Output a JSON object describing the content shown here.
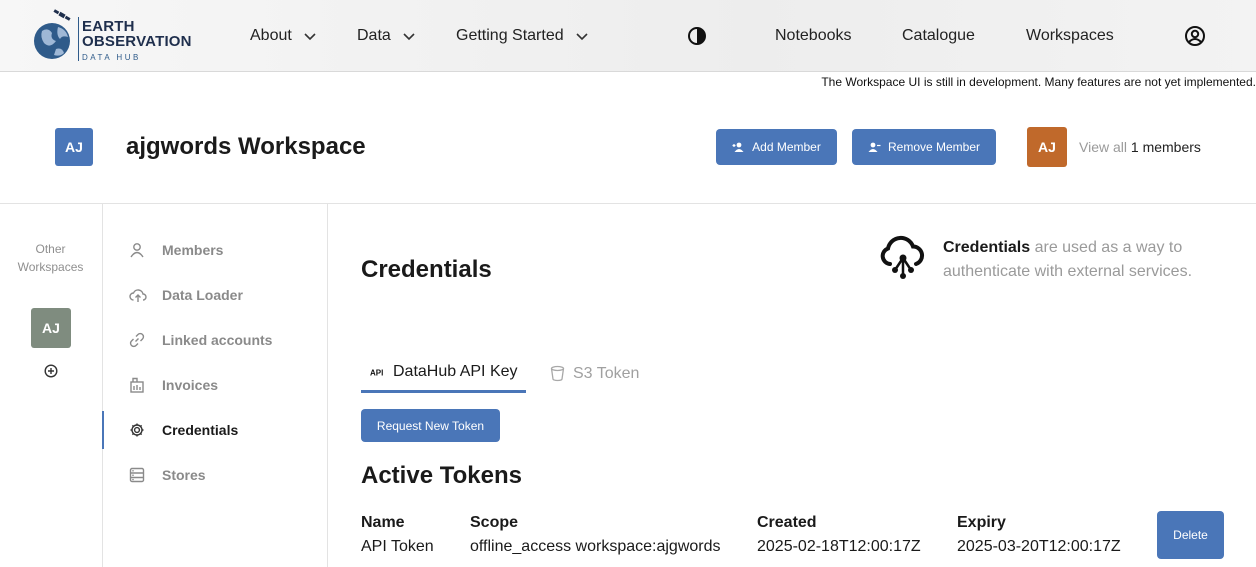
{
  "brand": {
    "line1": "EARTH",
    "line2": "OBSERVATION",
    "line3": "DATA HUB"
  },
  "nav": {
    "about": "About",
    "data": "Data",
    "getting_started": "Getting Started",
    "notebooks": "Notebooks",
    "catalogue": "Catalogue",
    "workspaces": "Workspaces"
  },
  "notice": "The Workspace UI is still in development. Many features are not yet implemented.",
  "workspace": {
    "initials": "AJ",
    "title": "ajgwords Workspace",
    "add_member": "Add Member",
    "remove_member": "Remove Member",
    "member_initials": "AJ",
    "view_all": "View all",
    "members_count": "1 members"
  },
  "rail": {
    "label": "Other Workspaces",
    "avatar": "AJ"
  },
  "menu": [
    {
      "label": "Members",
      "icon": "person-icon"
    },
    {
      "label": "Data Loader",
      "icon": "cloud-upload-icon"
    },
    {
      "label": "Linked accounts",
      "icon": "link-icon"
    },
    {
      "label": "Invoices",
      "icon": "invoice-icon"
    },
    {
      "label": "Credentials",
      "icon": "gear-icon",
      "active": true
    },
    {
      "label": "Stores",
      "icon": "storage-icon"
    }
  ],
  "credentials": {
    "title": "Credentials",
    "desc_bold": "Credentials",
    "desc_rest": " are used as a way to authenticate with external services.",
    "tabs": [
      {
        "label": "DataHub API Key",
        "active": true
      },
      {
        "label": "S3 Token",
        "active": false
      }
    ],
    "request_button": "Request New Token",
    "active_tokens_title": "Active Tokens",
    "columns": [
      "Name",
      "Scope",
      "Created",
      "Expiry"
    ],
    "rows": [
      {
        "name": "API Token",
        "scope": "offline_access workspace:ajgwords",
        "created": "2025-02-18T12:00:17Z",
        "expiry": "2025-03-20T12:00:17Z",
        "delete_label": "Delete"
      }
    ]
  },
  "colors": {
    "accent": "#4a76b8",
    "member_avatar": "#c0692b",
    "rail_avatar": "#7f8c7f"
  }
}
